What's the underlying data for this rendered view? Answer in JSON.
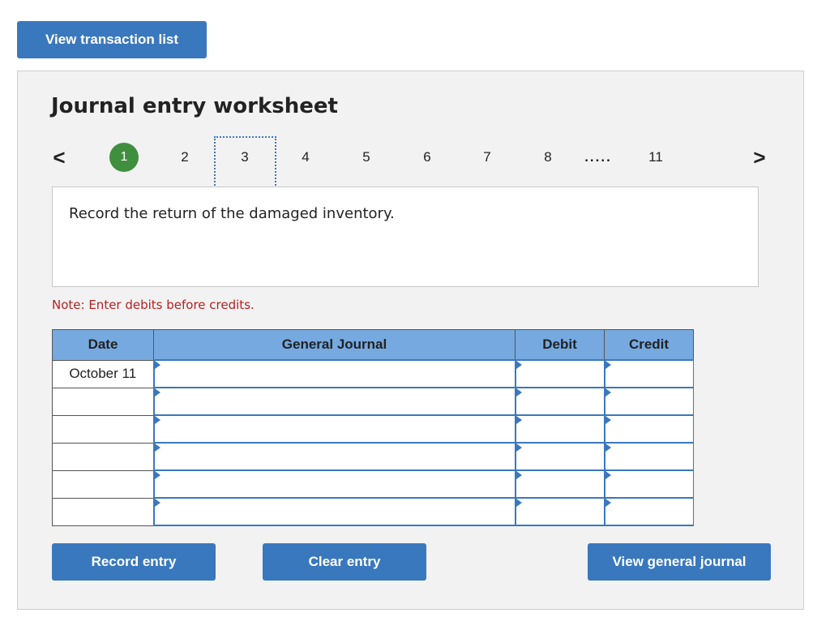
{
  "top_button": "View transaction list",
  "worksheet": {
    "title": "Journal entry worksheet",
    "pager": {
      "prev": "<",
      "next": ">",
      "pages": [
        "1",
        "2",
        "3",
        "4",
        "5",
        "6",
        "7",
        "8",
        ".....",
        "11"
      ],
      "active": "1",
      "focused": "3",
      "active_color": "#3f8f3f"
    },
    "prompt": "Record the return of the damaged inventory.",
    "note": "Note: Enter debits before credits.",
    "table": {
      "headers": [
        "Date",
        "General Journal",
        "Debit",
        "Credit"
      ],
      "rows": [
        {
          "date": "October 11"
        },
        {
          "date": ""
        },
        {
          "date": ""
        },
        {
          "date": ""
        },
        {
          "date": ""
        },
        {
          "date": ""
        }
      ],
      "header_color": "#76a9e0"
    },
    "buttons": {
      "record": "Record entry",
      "clear": "Clear entry",
      "view_general_journal": "View general journal"
    }
  },
  "colors": {
    "button": "#3a78be",
    "note": "#b22222"
  }
}
